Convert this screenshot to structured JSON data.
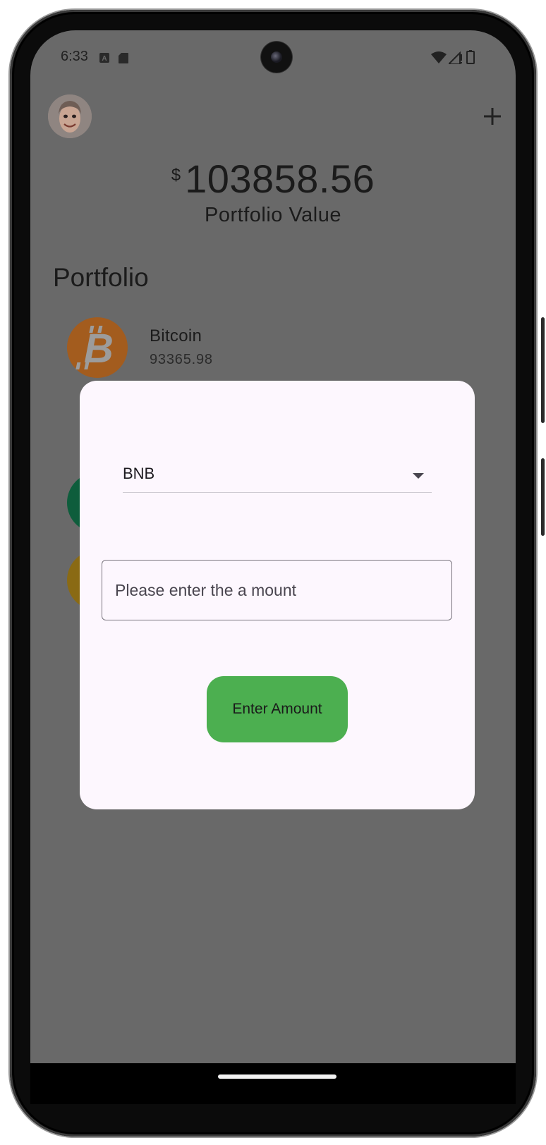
{
  "status_bar": {
    "time": "6:33",
    "icons": [
      "keyboard-icon",
      "sd-card-icon",
      "wifi-icon",
      "signal-icon",
      "battery-icon"
    ]
  },
  "header": {
    "avatar": "avatar-icon",
    "add_icon": "plus-icon"
  },
  "portfolio_summary": {
    "currency_symbol": "$",
    "value": "103858.56",
    "label": "Portfolio Value"
  },
  "portfolio": {
    "title": "Portfolio",
    "items": [
      {
        "name": "Bitcoin",
        "amount": "93365.98",
        "icon": "bitcoin-icon",
        "color": "#a35c1e"
      },
      {
        "name": "",
        "amount": "",
        "icon": "coin-icon",
        "color": "#0e5d3c"
      },
      {
        "name": "",
        "amount": "",
        "icon": "coin-icon",
        "color": "#8a6a14"
      }
    ]
  },
  "dialog": {
    "selected_coin": "BNB",
    "amount_placeholder": "Please enter the a mount",
    "amount_value": "",
    "submit_label": "Enter Amount",
    "submit_color": "#4caf50"
  },
  "colors": {
    "scrim": "#696969",
    "dialog_bg": "#fdf7fe"
  }
}
